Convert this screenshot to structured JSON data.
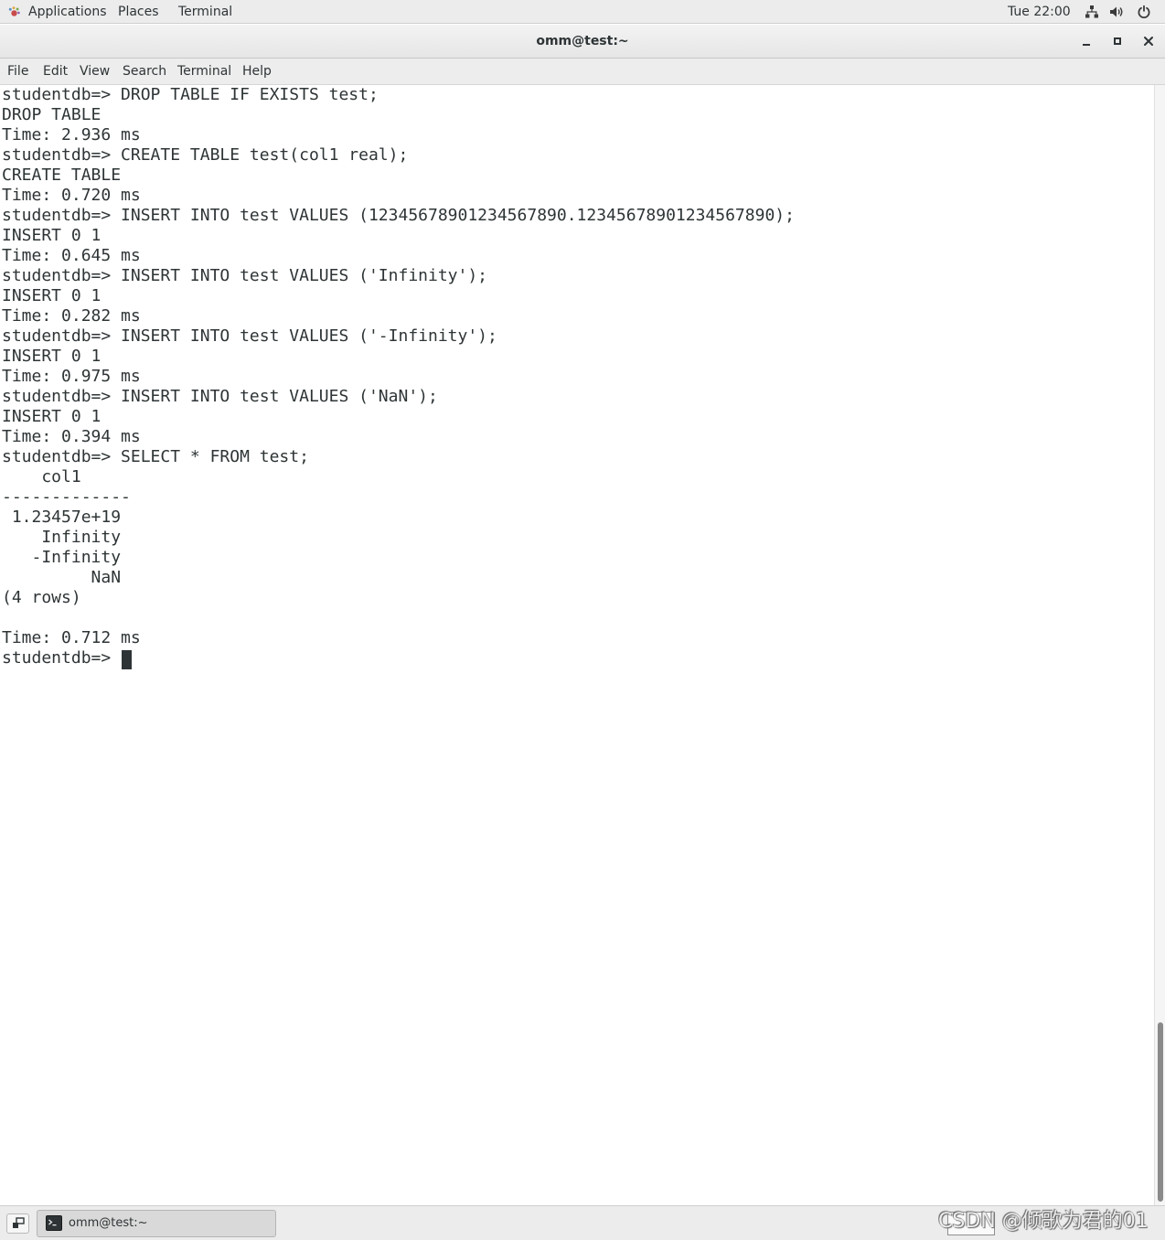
{
  "topbar": {
    "applications": "Applications",
    "places": "Places",
    "terminal": "Terminal",
    "clock": "Tue 22:00"
  },
  "window": {
    "title": "omm@test:~"
  },
  "menubar": {
    "items": [
      "File",
      "Edit",
      "View",
      "Search",
      "Terminal",
      "Help"
    ]
  },
  "terminal": {
    "lines": [
      "studentdb=> DROP TABLE IF EXISTS test;",
      "DROP TABLE",
      "Time: 2.936 ms",
      "studentdb=> CREATE TABLE test(col1 real);",
      "CREATE TABLE",
      "Time: 0.720 ms",
      "studentdb=> INSERT INTO test VALUES (12345678901234567890.12345678901234567890);",
      "INSERT 0 1",
      "Time: 0.645 ms",
      "studentdb=> INSERT INTO test VALUES ('Infinity');",
      "INSERT 0 1",
      "Time: 0.282 ms",
      "studentdb=> INSERT INTO test VALUES ('-Infinity');",
      "INSERT 0 1",
      "Time: 0.975 ms",
      "studentdb=> INSERT INTO test VALUES ('NaN');",
      "INSERT 0 1",
      "Time: 0.394 ms",
      "studentdb=> SELECT * FROM test;",
      "    col1",
      "-------------",
      " 1.23457e+19",
      "    Infinity",
      "   -Infinity",
      "         NaN",
      "(4 rows)",
      "",
      "Time: 0.712 ms",
      "studentdb=> "
    ]
  },
  "taskbar": {
    "task_label": "omm@test:~"
  },
  "watermark": "CSDN @倾歌为君的01"
}
